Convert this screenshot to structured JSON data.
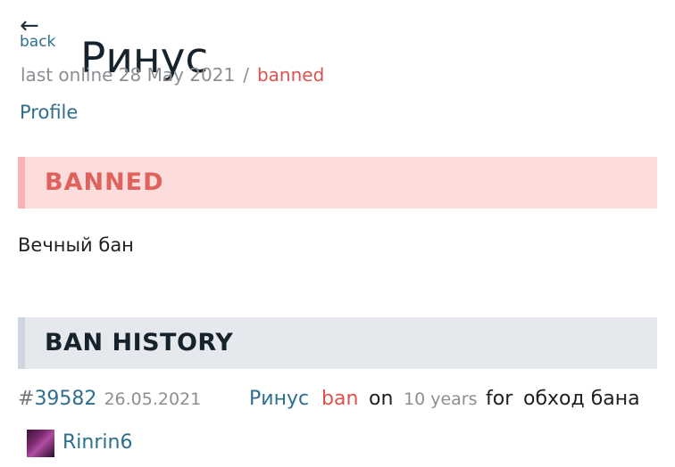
{
  "header": {
    "back_arrow": "←",
    "back_label": "back",
    "title": "Ринус"
  },
  "meta": {
    "last_online": "last online 28 May 2021",
    "separator": "/",
    "status": "banned"
  },
  "nav": {
    "profile_label": "Profile"
  },
  "ban_banner": {
    "title": "BANNED",
    "reason": "Вечный бан"
  },
  "ban_history": {
    "title": "BAN HISTORY",
    "entries": [
      {
        "hash": "#",
        "id": "39582",
        "date": "26.05.2021",
        "user": "Ринус",
        "action": "ban",
        "on": "on",
        "duration": "10 years",
        "for": "for",
        "reason": "обход бана",
        "moderator": "Rinrin6"
      }
    ]
  },
  "colors": {
    "link": "#2e6f8e",
    "danger": "#d9534f",
    "banner_bg": "#fddcdc",
    "history_bg": "#e5e9ee"
  },
  "icons": {
    "back": "left-arrow-icon"
  }
}
